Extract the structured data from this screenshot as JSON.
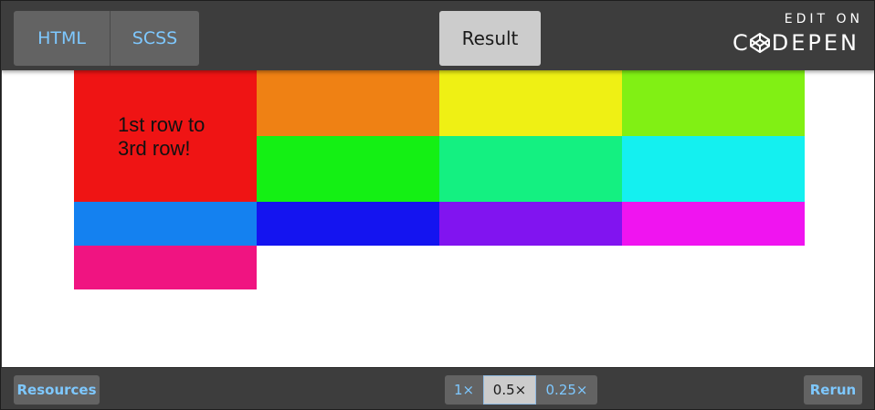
{
  "editor": {
    "tabs": [
      {
        "label": "HTML"
      },
      {
        "label": "SCSS"
      }
    ],
    "result_tab": "Result"
  },
  "brand": {
    "edit_on": "EDIT ON",
    "name_first": "C",
    "name_rest": "DEPEN"
  },
  "result": {
    "cells": [
      {
        "name": "red",
        "color": "#ef1414",
        "label": "1st row to\n3rd row!"
      },
      {
        "name": "orange",
        "color": "#ef8114"
      },
      {
        "name": "yellow",
        "color": "#eff014"
      },
      {
        "name": "lime",
        "color": "#81f014"
      },
      {
        "name": "green",
        "color": "#14f014"
      },
      {
        "name": "spring-green",
        "color": "#14f081"
      },
      {
        "name": "cyan",
        "color": "#14f0f0"
      },
      {
        "name": "azure",
        "color": "#1481f0"
      },
      {
        "name": "blue",
        "color": "#1414f0"
      },
      {
        "name": "violet",
        "color": "#8114f0"
      },
      {
        "name": "magenta",
        "color": "#f014f0"
      },
      {
        "name": "rose",
        "color": "#f01481"
      }
    ]
  },
  "footer": {
    "resources_label": "Resources",
    "zoom_options": [
      "1×",
      "0.5×",
      "0.25×"
    ],
    "zoom_selected": "0.5×",
    "rerun_label": "Rerun"
  },
  "colors": {
    "accent": "#7ec8ff",
    "bar_bg": "#3d3d3d",
    "button_bg": "#636363",
    "active_bg": "#cccccc"
  }
}
